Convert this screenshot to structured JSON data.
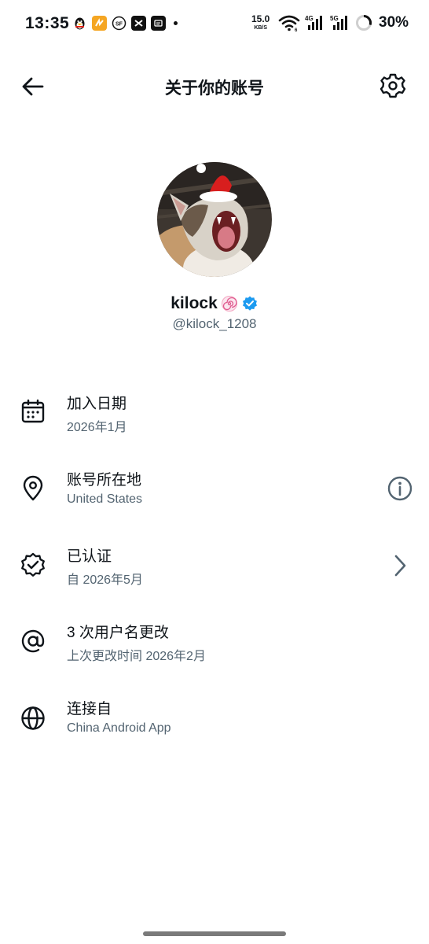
{
  "status_bar": {
    "time": "13:35",
    "net_speed": "15.0",
    "net_unit": "KB/S",
    "network_4g": "4G",
    "network_5g": "5G",
    "battery": "30%"
  },
  "header": {
    "title": "关于你的账号"
  },
  "profile": {
    "display_name": "kilock",
    "handle": "@kilock_1208",
    "verified_color": "#1d9bf0"
  },
  "info_rows": [
    {
      "title": "加入日期",
      "subtitle": "2026年1月",
      "icon": "calendar-icon"
    },
    {
      "title": "账号所在地",
      "subtitle": "United States",
      "icon": "location-pin-icon",
      "trailing": "info-icon"
    },
    {
      "title": "已认证",
      "subtitle": "自 2026年5月",
      "icon": "verified-badge-icon",
      "trailing": "chevron-right-icon"
    },
    {
      "title": "3 次用户名更改",
      "subtitle": "上次更改时间 2026年2月",
      "icon": "at-sign-icon"
    },
    {
      "title": "连接自",
      "subtitle": "China Android App",
      "icon": "globe-icon"
    }
  ],
  "colors": {
    "text_primary": "#0f1419",
    "text_secondary": "#536471",
    "accent": "#1d9bf0"
  }
}
